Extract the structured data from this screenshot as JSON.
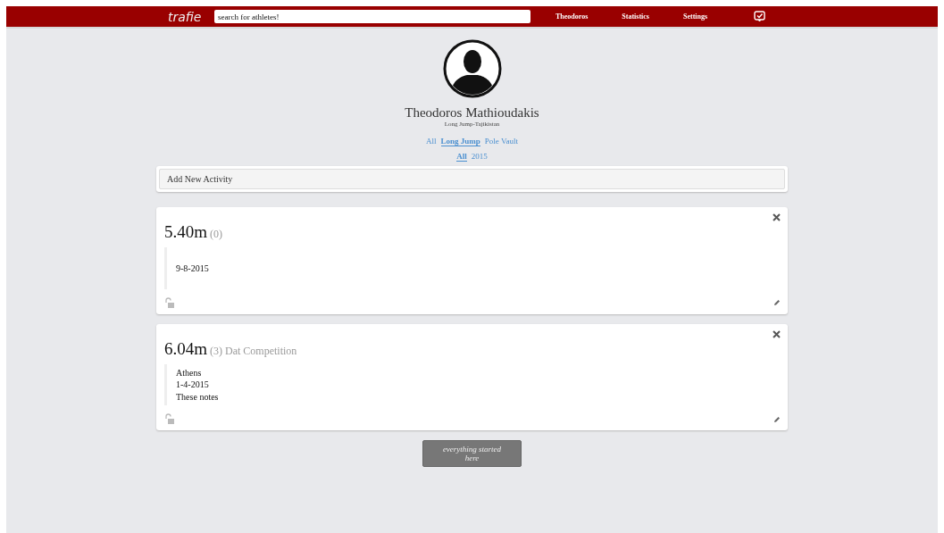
{
  "navbar": {
    "logo": "trafie",
    "search": {
      "placeholder": "search for athletes!"
    },
    "links": [
      "Theodoros",
      "Statistics",
      "Settings"
    ]
  },
  "profile": {
    "name": "Theodoros Mathioudakis",
    "subtitle": "Long Jump-Tajikistan"
  },
  "discipline_filters": [
    {
      "label": "All",
      "selected": false
    },
    {
      "label": "Long Jump",
      "selected": true
    },
    {
      "label": "Pole Vault",
      "selected": false
    }
  ],
  "year_filters": [
    {
      "label": "All",
      "selected": true
    },
    {
      "label": "2015",
      "selected": false
    }
  ],
  "add_activity": {
    "label": "Add New Activity"
  },
  "activities": [
    {
      "performance": "5.40m",
      "rank": "(0)",
      "date": "9-8-2015",
      "locked": false
    },
    {
      "performance": "6.04m",
      "rank": "(3)",
      "competition": "Dat Competition",
      "location": "Athens",
      "date": "1-4-2015",
      "notes": "These notes",
      "locked": false
    }
  ],
  "footer_button": "everything started here"
}
